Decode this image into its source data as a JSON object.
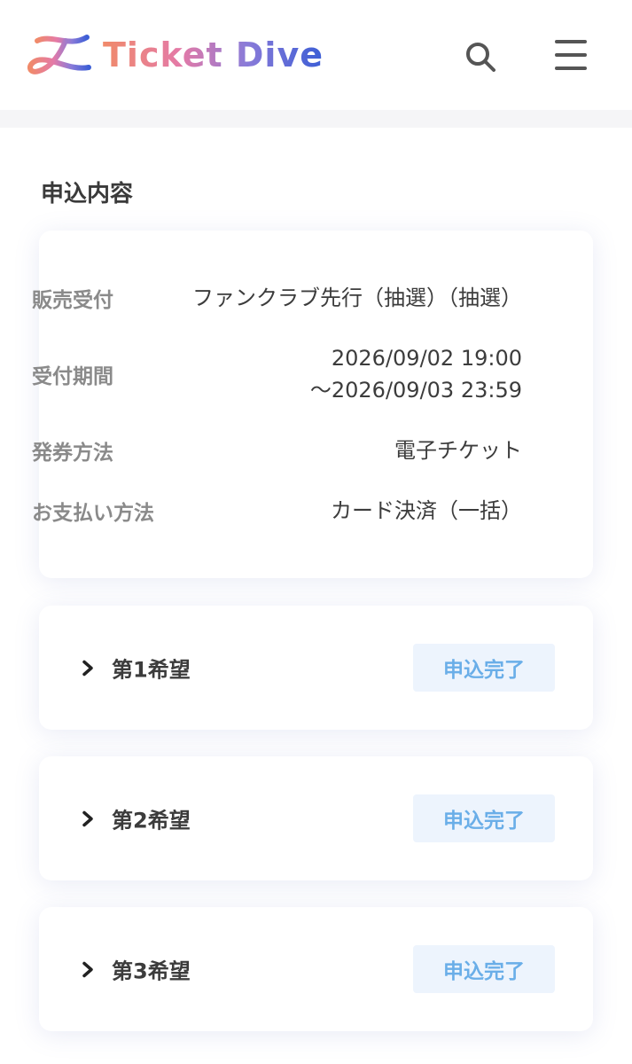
{
  "header": {
    "brand": "Ticket Dive",
    "icons": [
      "logo-icon",
      "search-icon",
      "hamburger-menu-icon"
    ]
  },
  "section": {
    "title": "申込内容"
  },
  "info": {
    "rows": [
      {
        "label": "販売受付",
        "value_lines": [
          "ファンクラブ先行（抽選）（抽選）"
        ]
      },
      {
        "label": "受付期間",
        "value_lines": [
          "2026/09/02 19:00",
          "～2026/09/03 23:59"
        ]
      },
      {
        "label": "発券方法",
        "value_lines": [
          "電子チケット"
        ]
      },
      {
        "label": "お支払い方法",
        "value_lines": [
          "カード決済（一括）"
        ]
      }
    ]
  },
  "preferences": [
    {
      "label": "第1希望",
      "status": "申込完了"
    },
    {
      "label": "第2希望",
      "status": "申込完了"
    },
    {
      "label": "第3希望",
      "status": "申込完了"
    }
  ],
  "colors": {
    "badge_bg": "#edf4fd",
    "badge_text": "#6aaee8",
    "brand_gradient": [
      "#f08a6a",
      "#e47aa7",
      "#8a7bd8",
      "#3c5ed6"
    ]
  }
}
